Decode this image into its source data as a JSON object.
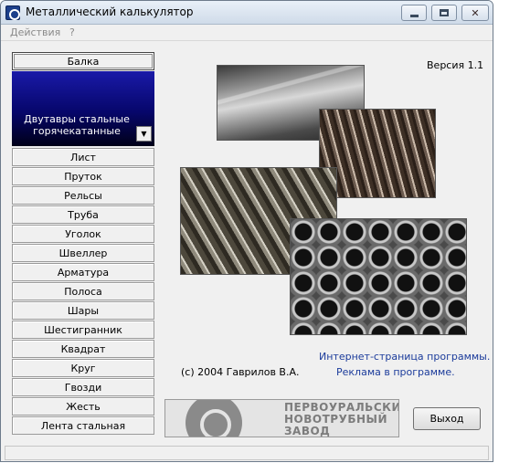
{
  "window": {
    "title": "Металлический калькулятор",
    "close_glyph": "✕"
  },
  "menu": {
    "actions": "Действия",
    "help": "?"
  },
  "categories": {
    "active": "Балка",
    "selected_subtype": "Двутавры стальные горячекатанные",
    "dropdown_glyph": "▼",
    "items": [
      "Лист",
      "Пруток",
      "Рельсы",
      "Труба",
      "Уголок",
      "Швеллер",
      "Арматура",
      "Полоса",
      "Шары",
      "Шестигранник",
      "Квадрат",
      "Круг",
      "Гвозди",
      "Жесть",
      "Лента стальная"
    ]
  },
  "info": {
    "version": "Версия 1.1",
    "copyright": "(c) 2004 Гаврилов В.А.",
    "link_site": "Интернет-страница программы.",
    "link_ads": "Реклама в программе."
  },
  "banner": {
    "line1": "ПЕРВОУРАЛЬСКИЙ",
    "line2": "НОВОТРУБНЫЙ",
    "line3": "ЗАВОД"
  },
  "buttons": {
    "exit": "Выход"
  },
  "colors": {
    "panel_gradient_top": "#1a1aa8",
    "panel_gradient_bottom": "#000018",
    "link": "#1b3b9b"
  }
}
